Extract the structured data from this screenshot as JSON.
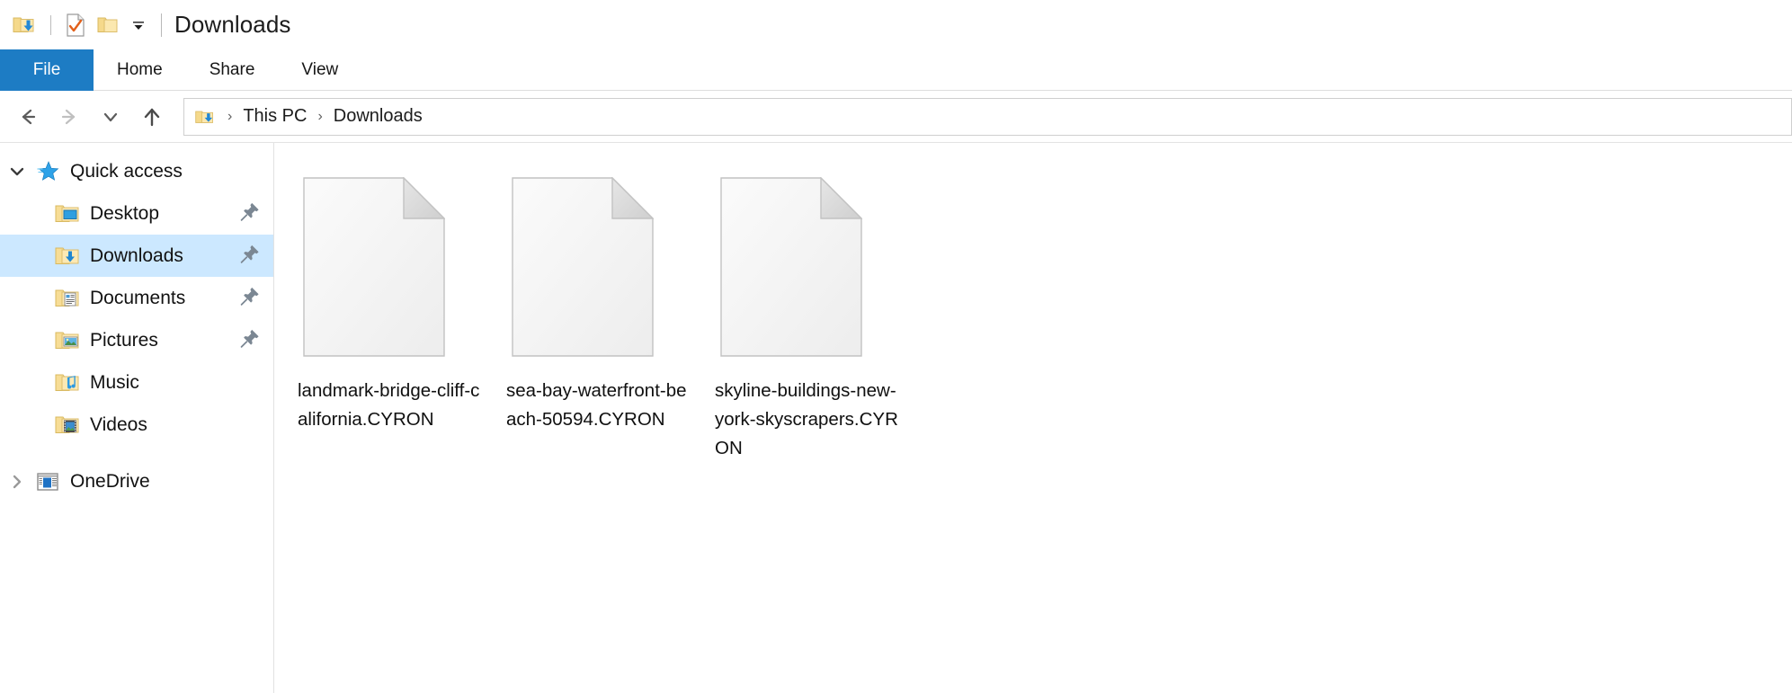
{
  "window": {
    "title": "Downloads",
    "accent_color": "#1d7cc4",
    "selection_color": "#cce8ff"
  },
  "quick_access_toolbar": {
    "items": [
      {
        "name": "downloads-folder-icon",
        "label": "Downloads"
      },
      {
        "name": "properties-icon",
        "label": "Properties"
      },
      {
        "name": "new-folder-icon",
        "label": "New folder"
      },
      {
        "name": "customize-dropdown-icon",
        "label": "Customize Quick Access Toolbar"
      }
    ]
  },
  "ribbon": {
    "tabs": [
      {
        "label": "File",
        "selected": true
      },
      {
        "label": "Home",
        "selected": false
      },
      {
        "label": "Share",
        "selected": false
      },
      {
        "label": "View",
        "selected": false
      }
    ]
  },
  "navigation": {
    "back_label": "Back",
    "forward_label": "Forward",
    "recent_label": "Recent locations",
    "up_label": "Up one level",
    "breadcrumb": {
      "icon": "downloads-folder-icon",
      "parts": [
        "This PC",
        "Downloads"
      ],
      "separator": "›"
    }
  },
  "sidebar": {
    "items": [
      {
        "label": "Quick access",
        "icon": "star-pin-icon",
        "level": 0,
        "expanded": true,
        "chevron": "down",
        "pinned": false,
        "selected": false
      },
      {
        "label": "Desktop",
        "icon": "desktop-folder-icon",
        "level": 1,
        "pinned": true,
        "selected": false
      },
      {
        "label": "Downloads",
        "icon": "downloads-folder-icon",
        "level": 1,
        "pinned": true,
        "selected": true
      },
      {
        "label": "Documents",
        "icon": "documents-folder-icon",
        "level": 1,
        "pinned": true,
        "selected": false
      },
      {
        "label": "Pictures",
        "icon": "pictures-folder-icon",
        "level": 1,
        "pinned": true,
        "selected": false
      },
      {
        "label": "Music",
        "icon": "music-folder-icon",
        "level": 1,
        "pinned": false,
        "selected": false
      },
      {
        "label": "Videos",
        "icon": "videos-folder-icon",
        "level": 1,
        "pinned": false,
        "selected": false
      },
      {
        "label": "OneDrive",
        "icon": "onedrive-icon",
        "level": 0,
        "expanded": false,
        "chevron": "right",
        "pinned": false,
        "selected": false
      }
    ]
  },
  "files": {
    "view": "large-icons",
    "items": [
      {
        "name": "landmark-bridge-cliff-california.CYRON",
        "icon": "generic-file-icon",
        "selected": false
      },
      {
        "name": "sea-bay-waterfront-beach-50594.CYRON",
        "icon": "generic-file-icon",
        "selected": false
      },
      {
        "name": "skyline-buildings-new-york-skyscrapers.CYRON",
        "icon": "generic-file-icon",
        "selected": false
      }
    ]
  }
}
